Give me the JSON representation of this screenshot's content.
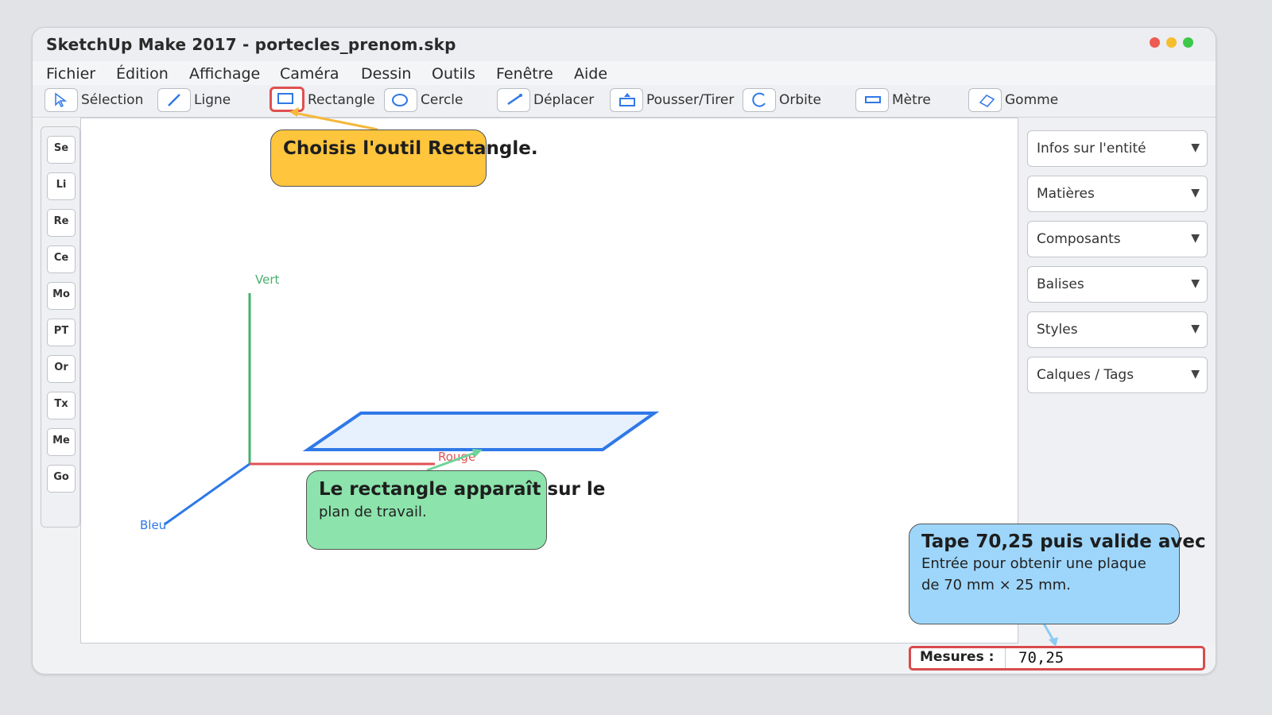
{
  "window": {
    "title": "SketchUp Make 2017 - portecles_prenom.skp"
  },
  "menu": [
    "Fichier",
    "Édition",
    "Affichage",
    "Caméra",
    "Dessin",
    "Outils",
    "Fenêtre",
    "Aide"
  ],
  "toolbar": {
    "select": "Sélection",
    "line": "Ligne",
    "rectangle": "Rectangle",
    "circle": "Cercle",
    "move": "Déplacer",
    "pushpull": "Pousser/Tirer",
    "orbit": "Orbite",
    "tape": "Mètre",
    "eraser": "Gomme"
  },
  "left_tools": [
    "Se",
    "Li",
    "Re",
    "Ce",
    "Mo",
    "PT",
    "Or",
    "Tx",
    "Me",
    "Go"
  ],
  "trays": [
    "Infos sur l'entité",
    "Matières",
    "Composants",
    "Balises",
    "Styles",
    "Calques / Tags"
  ],
  "tray_arrow": "▼",
  "axes": {
    "green": "Vert",
    "red": "Rouge",
    "blue": "Bleu"
  },
  "measurements": {
    "label": "Mesures :",
    "value": "70,25"
  },
  "callouts": {
    "tool": {
      "title": "Choisis l'outil Rectangle."
    },
    "plane": {
      "title": "Le rectangle apparaît sur le",
      "body": "plan de travail."
    },
    "measure": {
      "title": "Tape 70,25 puis valide avec",
      "body1": "Entrée pour obtenir une plaque",
      "body2": "de 70 mm × 25 mm."
    }
  },
  "colors": {
    "axis_green": "#47b06f",
    "axis_red": "#e05252",
    "axis_blue": "#2f78e8",
    "rect_stroke": "#2f78e8",
    "rect_fill": "#e6f1fd",
    "callout_yellow": "#ffc53d",
    "callout_green": "#8ce3ab",
    "callout_blue": "#9ed6fb",
    "highlight_red": "#d94b4b"
  }
}
